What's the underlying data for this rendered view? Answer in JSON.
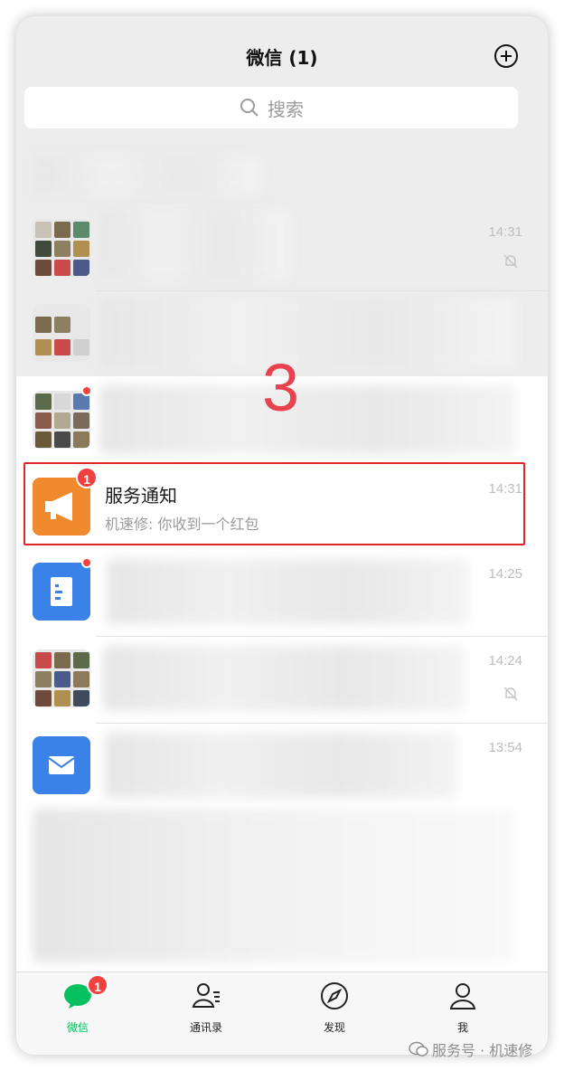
{
  "header": {
    "title": "微信 (1)",
    "plus_icon": "plus-circle-icon"
  },
  "search": {
    "placeholder": "搜索",
    "icon": "search-icon"
  },
  "chats": [
    {
      "time": "14:31",
      "muted": true,
      "avatar": "group-grid"
    },
    {
      "time": "",
      "muted": false,
      "avatar": "group-grid"
    },
    {
      "time": "",
      "muted": false,
      "avatar": "group-grid",
      "unread_dot": true
    },
    {
      "name": "服务通知",
      "preview": "机速修: 你收到一个红包",
      "time": "14:31",
      "badge": "1",
      "avatar": "megaphone-icon",
      "avatar_color": "#f08a2e",
      "highlighted": true
    },
    {
      "time": "14:25",
      "avatar": "document-icon",
      "avatar_color": "#3b82e8",
      "unread_dot": true
    },
    {
      "time": "14:24",
      "muted": true,
      "avatar": "group-grid"
    },
    {
      "time": "13:54",
      "avatar": "mail-icon",
      "avatar_color": "#3b82e8"
    }
  ],
  "overlay_step": "3",
  "tabbar": {
    "tabs": [
      {
        "label": "微信",
        "icon": "chat-bubble-icon",
        "active": true,
        "badge": "1"
      },
      {
        "label": "通讯录",
        "icon": "contacts-icon",
        "active": false
      },
      {
        "label": "发现",
        "icon": "compass-icon",
        "active": false
      },
      {
        "label": "我",
        "icon": "person-icon",
        "active": false
      }
    ]
  },
  "watermark": {
    "text": "服务号 · 机速修",
    "icon": "wechat-logo-icon"
  },
  "colors": {
    "accent_green": "#07c160",
    "badge_red": "#f04040",
    "highlight_red": "#e0252b",
    "overlay_red": "#e8424e"
  }
}
